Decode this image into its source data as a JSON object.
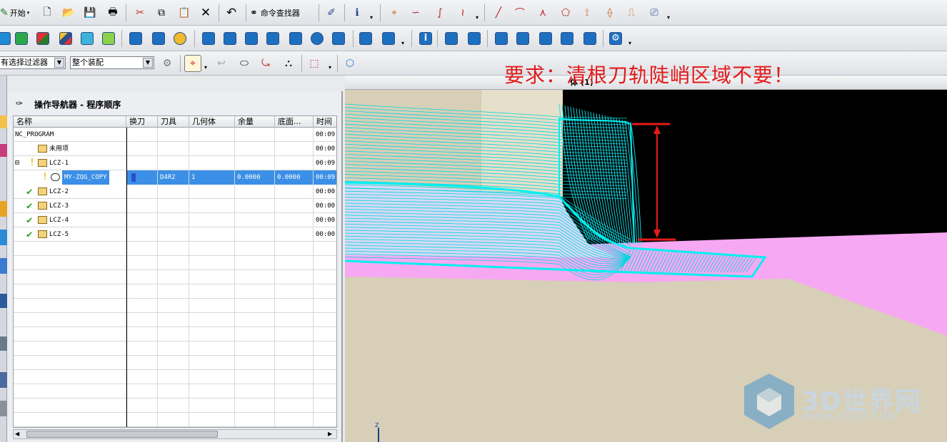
{
  "toolbar1": {
    "start_label": "开始",
    "command_finder_label": "命令查找器"
  },
  "selection_bar": {
    "filter_value": "有选择过滤器",
    "assembly_value": "整个装配"
  },
  "annotation": "要求：清根刀轨陡峭区域不要！",
  "viewport_title": "体 (1)",
  "navigator": {
    "title": "操作导航器 - 程序顺序",
    "columns": [
      "名称",
      "换刀",
      "刀具",
      "几何体",
      "余量",
      "底面...",
      "时间"
    ],
    "rows": [
      {
        "name": "NC_PROGRAM",
        "tool": "",
        "geometry": "",
        "stock": "",
        "floor": "",
        "time": "00:09",
        "level": 0,
        "status": ""
      },
      {
        "name": "未用项",
        "tool": "",
        "geometry": "",
        "stock": "",
        "floor": "",
        "time": "00:00",
        "level": 1,
        "status": ""
      },
      {
        "name": "LCZ-1",
        "tool": "",
        "geometry": "",
        "stock": "",
        "floor": "",
        "time": "00:09",
        "level": 1,
        "status": "warn"
      },
      {
        "name": "MY-ZQG_COPY",
        "tool": "D4R2",
        "geometry": "1",
        "stock": "0.0000",
        "floor": "0.0000",
        "time": "00:09",
        "level": 2,
        "status": "warn"
      },
      {
        "name": "LCZ-2",
        "tool": "",
        "geometry": "",
        "stock": "",
        "floor": "",
        "time": "00:00",
        "level": 1,
        "status": "ok"
      },
      {
        "name": "LCZ-3",
        "tool": "",
        "geometry": "",
        "stock": "",
        "floor": "",
        "time": "00:00",
        "level": 1,
        "status": "ok"
      },
      {
        "name": "LCZ-4",
        "tool": "",
        "geometry": "",
        "stock": "",
        "floor": "",
        "time": "00:00",
        "level": 1,
        "status": "ok"
      },
      {
        "name": "LCZ-5",
        "tool": "",
        "geometry": "",
        "stock": "",
        "floor": "",
        "time": "00:00",
        "level": 1,
        "status": "ok"
      }
    ]
  },
  "axis_label": "Z",
  "watermark": {
    "brand": "3D世界网",
    "url": "WWW.3DSJW.COM"
  },
  "colors": {
    "toolpath": "#00f0f0",
    "part_floor": "#f7a8f2",
    "background_black": "#000000",
    "annotation_red": "#e41b1b",
    "selection_blue": "#3b8fe6"
  }
}
